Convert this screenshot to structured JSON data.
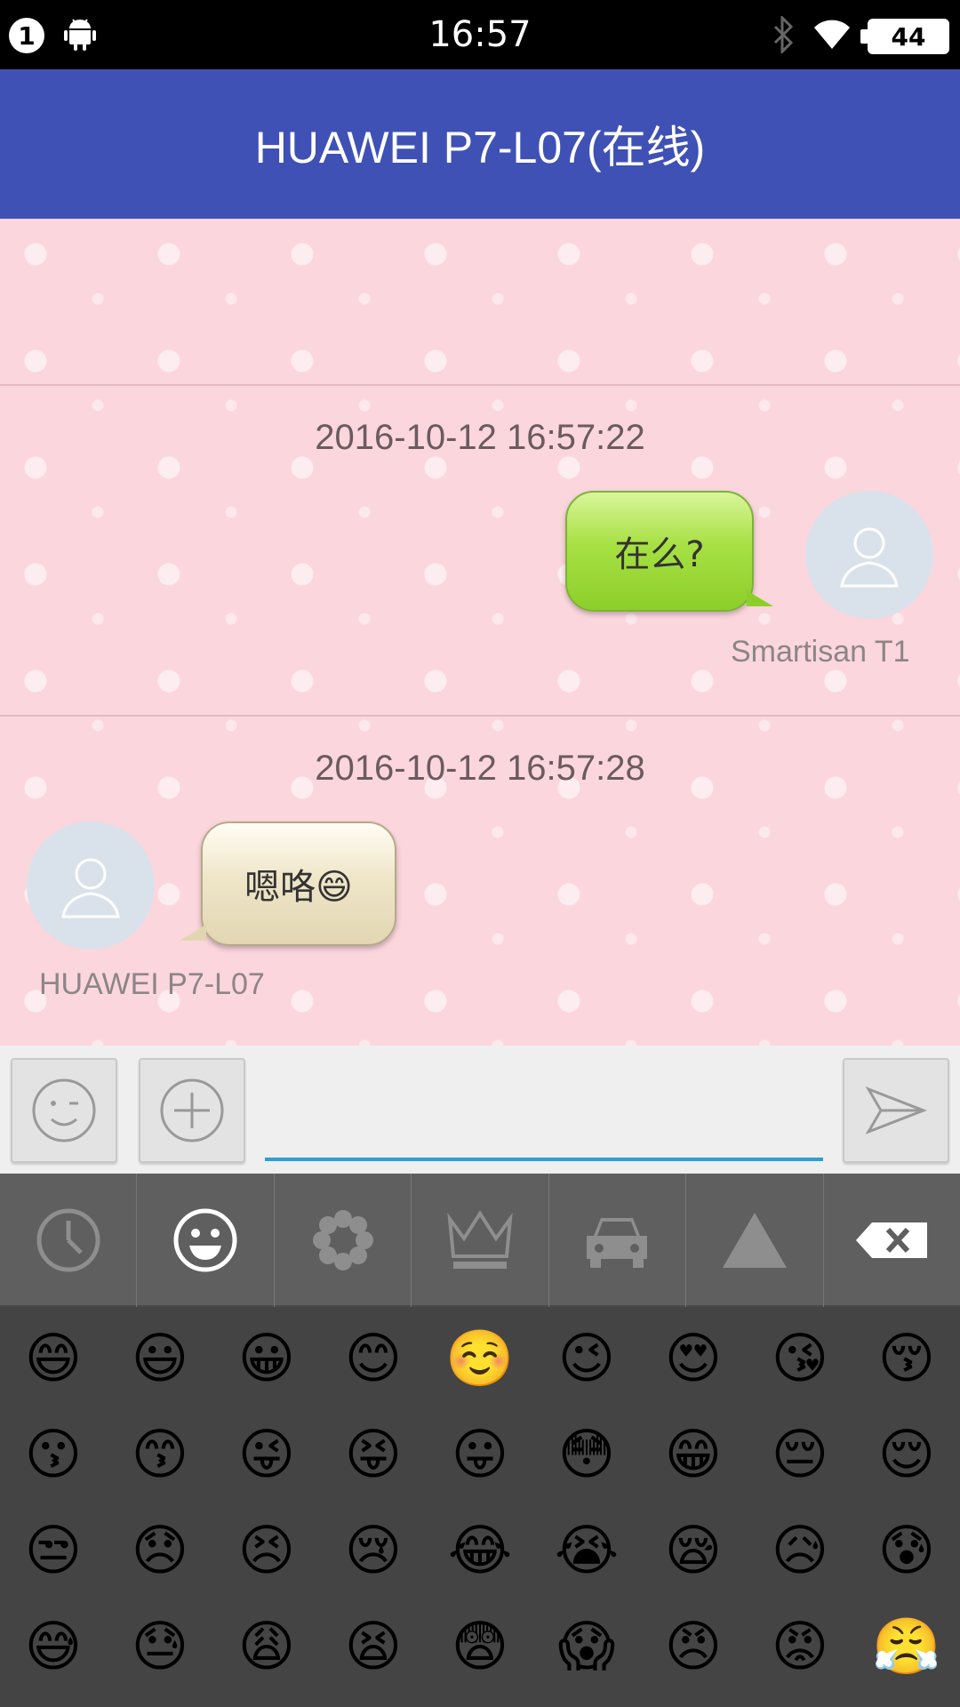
{
  "status_bar": {
    "notification_count": "1",
    "time": "16:57",
    "battery": "44"
  },
  "header": {
    "title": "HUAWEI P7-L07(在线)"
  },
  "messages": [
    {
      "timestamp": "2016-10-12 16:57:22",
      "direction": "outgoing",
      "text": "在么?",
      "sender": "Smartisan T1"
    },
    {
      "timestamp": "2016-10-12 16:57:28",
      "direction": "incoming",
      "text": "嗯咯😄",
      "sender": "HUAWEI P7-L07"
    }
  ],
  "input": {
    "value": "",
    "placeholder": ""
  },
  "emoji_tabs": [
    "clock-icon",
    "smiley-icon",
    "flower-icon",
    "crown-icon",
    "car-icon",
    "triangle-icon",
    "backspace-icon"
  ],
  "emoji_grid": {
    "rows": [
      [
        "😄",
        "😃",
        "😀",
        "😊",
        "☺️",
        "😉",
        "😍",
        "😘",
        "😚"
      ],
      [
        "😗",
        "😙",
        "😜",
        "😝",
        "😛",
        "😳",
        "😁",
        "😔",
        "😌"
      ],
      [
        "😒",
        "😞",
        "😣",
        "😢",
        "😂",
        "😭",
        "😪",
        "😥",
        "😰"
      ],
      [
        "😅",
        "😓",
        "😩",
        "😫",
        "😨",
        "😱",
        "😠",
        "😡",
        "😤"
      ]
    ]
  },
  "colors": {
    "app_bar": "#3f51b5",
    "chat_bg": "#fbd6dd",
    "input_underline": "#2aa0d6",
    "emoji_panel": "#444444"
  }
}
